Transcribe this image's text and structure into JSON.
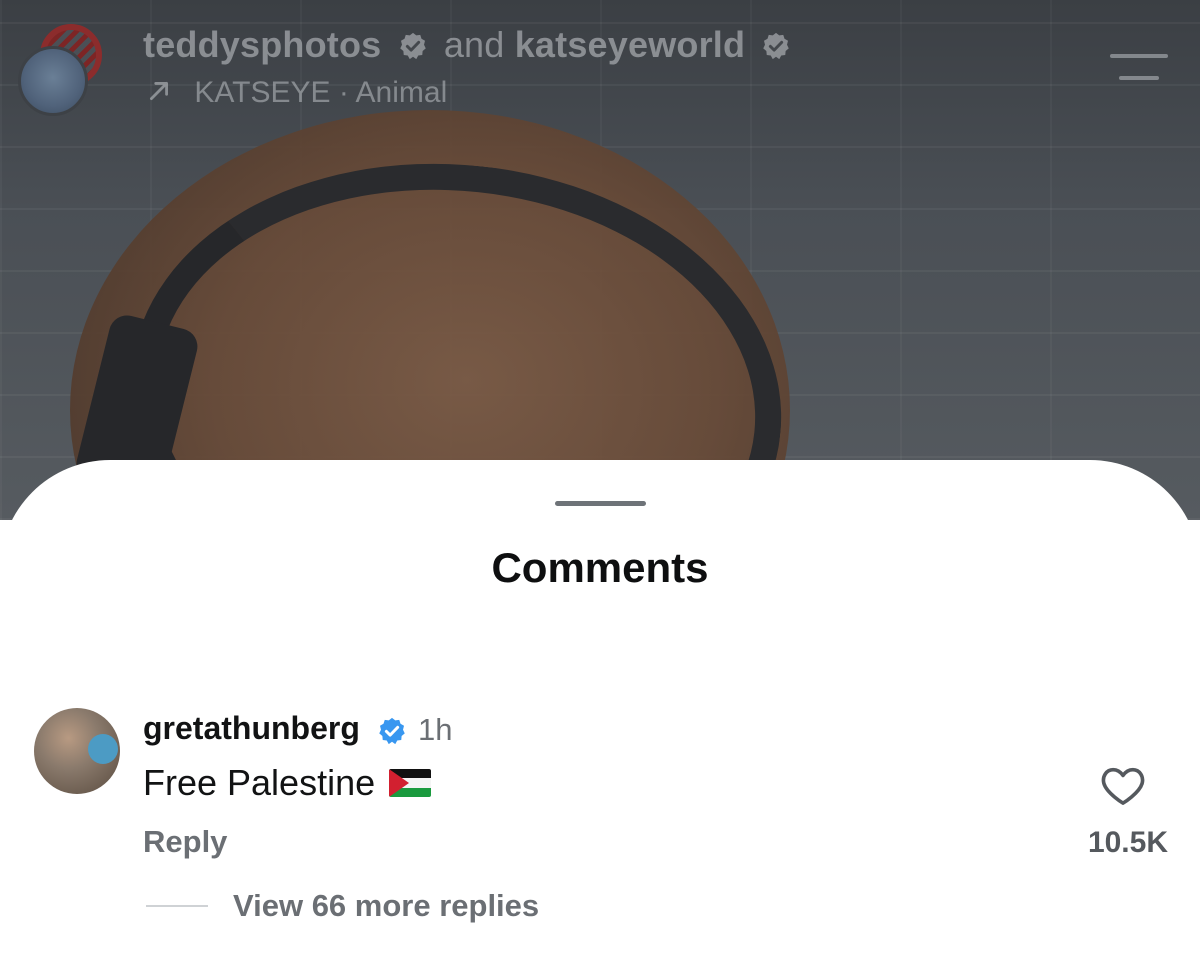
{
  "header": {
    "user1": "teddysphotos",
    "and": "and",
    "user2": "katseyeworld",
    "audio_artist": "KATSEYE",
    "separator": "·",
    "audio_title": "Animal",
    "icons": [
      "verified-badge-icon",
      "arrow-up-right-icon",
      "menu-icon"
    ]
  },
  "comments_sheet": {
    "title": "Comments",
    "comment": {
      "username": "gretathunberg",
      "time": "1h",
      "text": "Free Palestine",
      "reply_label": "Reply",
      "like_count": "10.5K",
      "view_more_label": "View 66 more replies"
    }
  },
  "colors": {
    "verified_blue": "#3897f0",
    "text_primary": "#121314",
    "text_secondary": "#6b6f74"
  }
}
